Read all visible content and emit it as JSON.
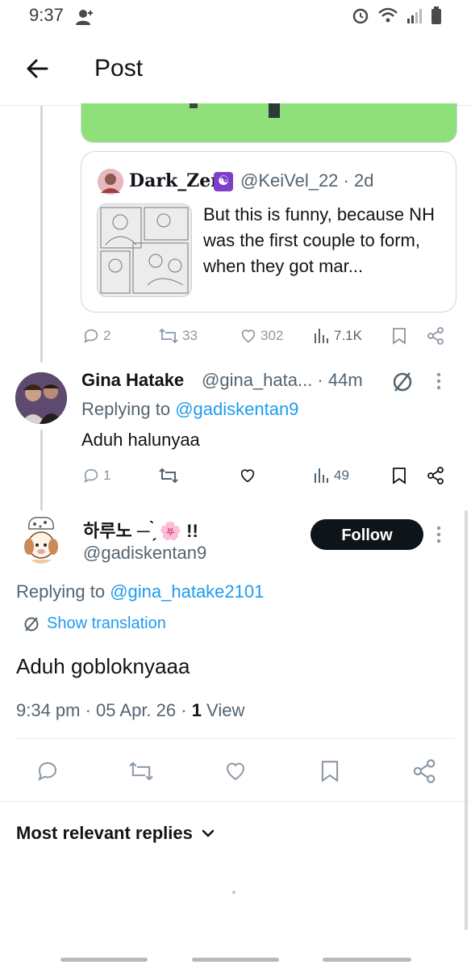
{
  "status": {
    "time": "9:37"
  },
  "header": {
    "title": "Post"
  },
  "quote": {
    "name": "Dark_Zer",
    "badge": "☯",
    "handle": "@KeiVel_22 · 2d",
    "text": "But this is funny, because NH was the first couple to form, when they got mar..."
  },
  "parent_actions": {
    "replies": "2",
    "reposts": "33",
    "likes": "302",
    "views": "7.1K"
  },
  "reply1": {
    "name": "Gina Hatake",
    "handle": "@gina_hata... · 44m",
    "replying_prefix": "Replying to",
    "replying_to": "@gadiskentan9",
    "text": "Aduh halunyaa",
    "actions": {
      "replies": "1",
      "views": "49"
    }
  },
  "main": {
    "name": "하루노 ─ ̗̀ 🌸 !!",
    "handle": "@gadiskentan9",
    "follow_label": "Follow",
    "replying_prefix": "Replying to",
    "replying_to": "@gina_hatake2101",
    "translate_label": "Show translation",
    "text": "Aduh gobloknyaaa",
    "time": "9:34 pm · 05 Apr. 26 · ",
    "views_count": "1",
    "views_label": " View"
  },
  "sort": {
    "label": "Most relevant replies"
  },
  "colors": {
    "accent": "#1d9bf0",
    "text": "#0f1419",
    "muted": "#536471",
    "border": "#cfd9de"
  },
  "icons": [
    "back-arrow-icon",
    "reply-icon",
    "repost-icon",
    "like-icon",
    "views-icon",
    "bookmark-icon",
    "share-icon",
    "more-icon",
    "translate-icon",
    "chevron-down-icon"
  ]
}
